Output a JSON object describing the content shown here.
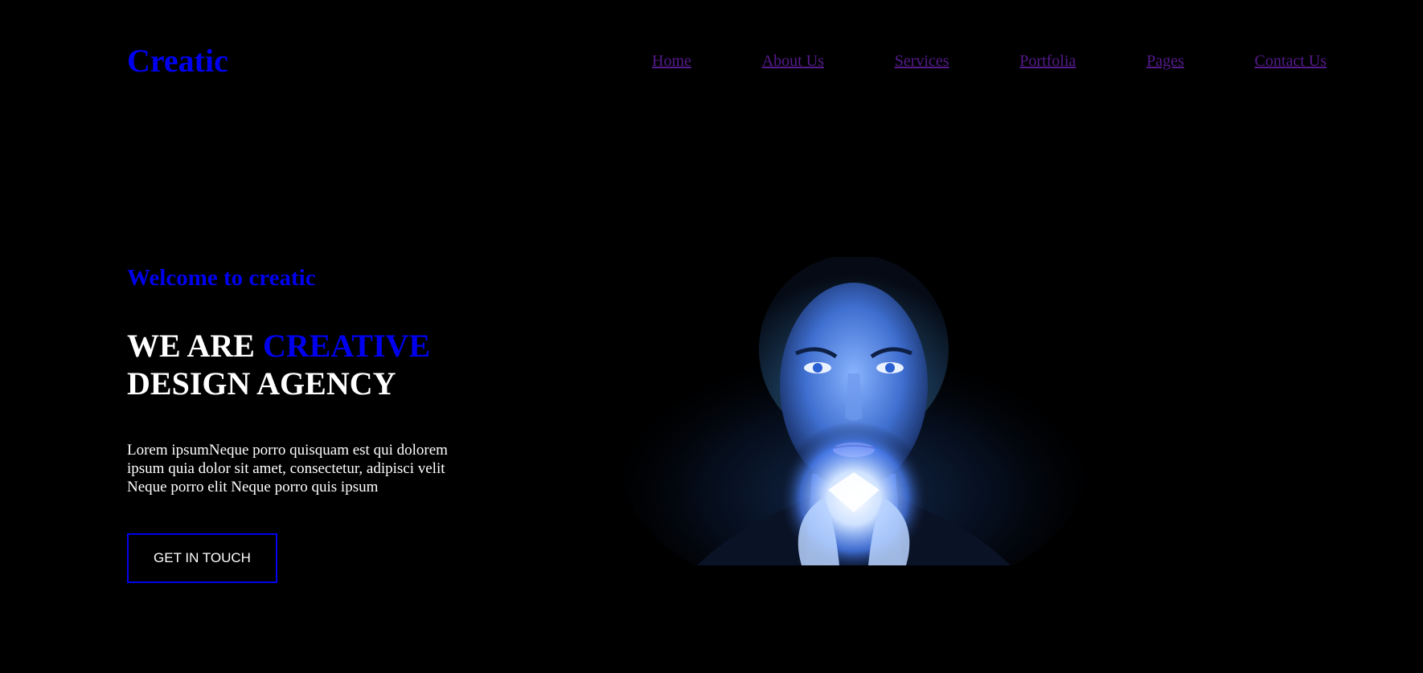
{
  "header": {
    "logo": "Creatic",
    "nav": [
      "Home",
      "About Us",
      "Services",
      "Portfolia",
      "Pages",
      "Contact Us"
    ]
  },
  "hero": {
    "welcome": "Welcome to creatic",
    "headline_part1": "WE ARE ",
    "headline_accent": "CREATIVE",
    "headline_part2": "DESIGN AGENCY",
    "paragraph": "Lorem ipsumNeque porro quisquam est qui dolorem ipsum quia dolor sit amet, consectetur, adipisci velit Neque porro elit Neque porro quis ipsum",
    "cta_label": "GET IN TOUCH"
  },
  "colors": {
    "background": "#000000",
    "accent": "#0000ee",
    "nav_link": "#551a8b",
    "text": "#ffffff"
  }
}
